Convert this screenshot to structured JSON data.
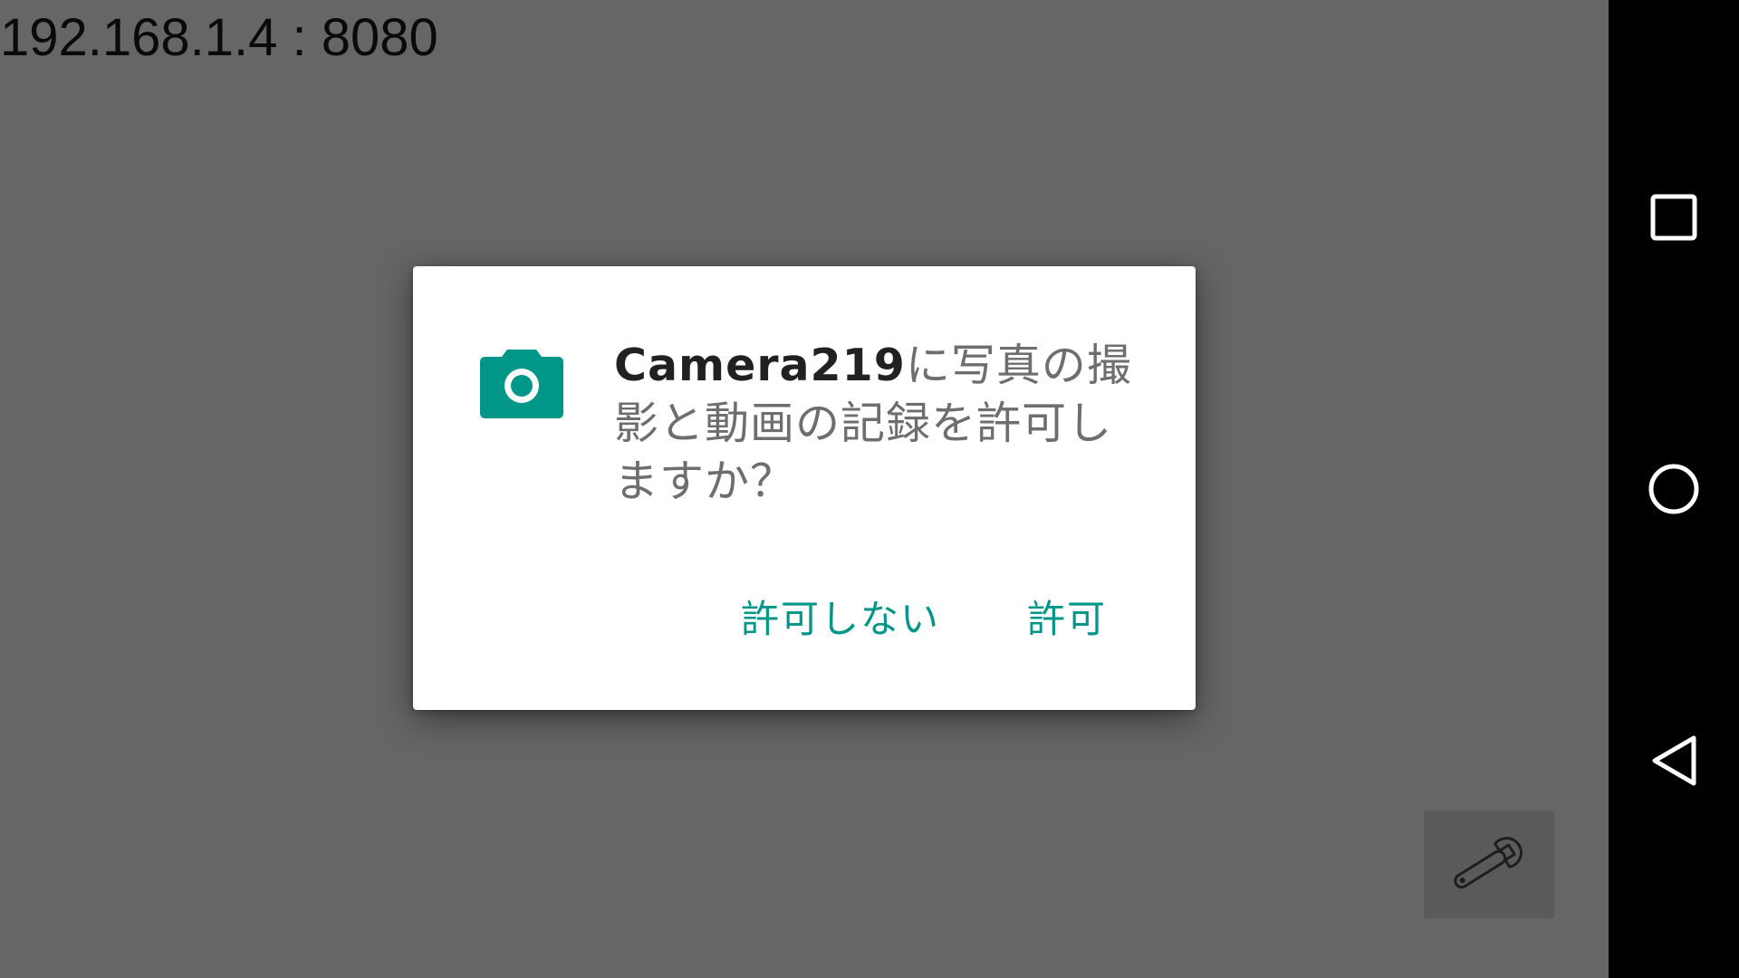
{
  "status": {
    "address": "192.168.1.4 : 8080"
  },
  "dialog": {
    "app_name": "Camera219",
    "message_rest": "に写真の撮影と動画の記録を許可しますか？",
    "deny_label": "許可しない",
    "allow_label": "許可",
    "icon": "camera-icon"
  },
  "toolbar": {
    "settings_icon": "wrench-icon"
  },
  "nav": {
    "recents_icon": "square-icon",
    "home_icon": "circle-icon",
    "back_icon": "triangle-back-icon"
  },
  "colors": {
    "accent": "#009688",
    "background": "#666666",
    "nav_bar": "#000000"
  }
}
